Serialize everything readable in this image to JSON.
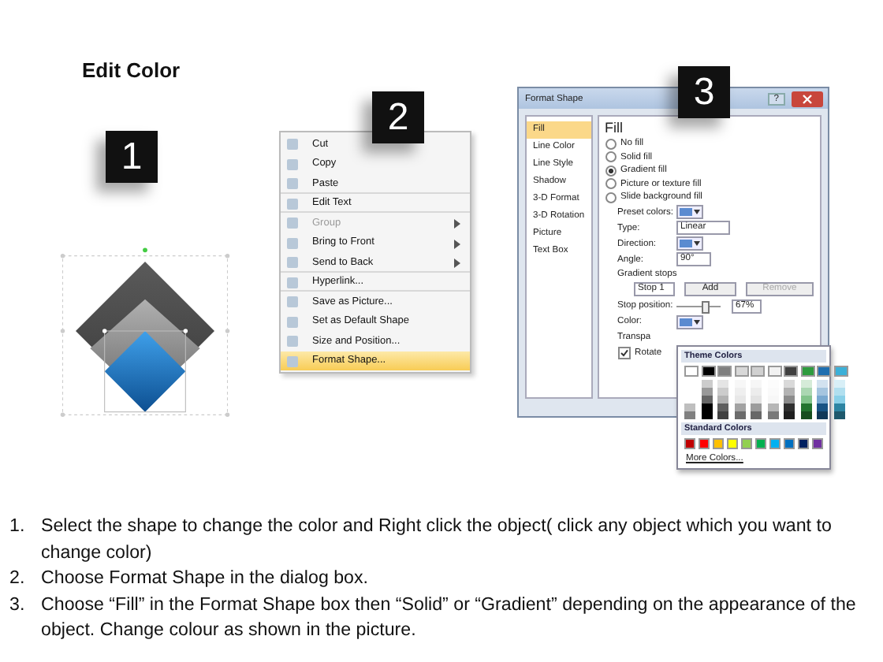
{
  "title": "Edit Color",
  "badges": [
    "1",
    "2",
    "3"
  ],
  "context_menu": {
    "items": [
      {
        "label": "Cut",
        "disabled": false,
        "submenu": false,
        "selected": false,
        "separator_after": false
      },
      {
        "label": "Copy",
        "disabled": false,
        "submenu": false,
        "selected": false,
        "separator_after": false
      },
      {
        "label": "Paste",
        "disabled": false,
        "submenu": false,
        "selected": false,
        "separator_after": true
      },
      {
        "label": "Edit Text",
        "disabled": false,
        "submenu": false,
        "selected": false,
        "separator_after": true
      },
      {
        "label": "Group",
        "disabled": true,
        "submenu": true,
        "selected": false,
        "separator_after": false
      },
      {
        "label": "Bring to Front",
        "disabled": false,
        "submenu": true,
        "selected": false,
        "separator_after": false
      },
      {
        "label": "Send to Back",
        "disabled": false,
        "submenu": true,
        "selected": false,
        "separator_after": true
      },
      {
        "label": "Hyperlink...",
        "disabled": false,
        "submenu": false,
        "selected": false,
        "separator_after": true
      },
      {
        "label": "Save as Picture...",
        "disabled": false,
        "submenu": false,
        "selected": false,
        "separator_after": false
      },
      {
        "label": "Set as Default Shape",
        "disabled": false,
        "submenu": false,
        "selected": false,
        "separator_after": false
      },
      {
        "label": "Size and Position...",
        "disabled": false,
        "submenu": false,
        "selected": false,
        "separator_after": false
      },
      {
        "label": "Format Shape...",
        "disabled": false,
        "submenu": false,
        "selected": true,
        "separator_after": false
      }
    ]
  },
  "dialog": {
    "title": "Format Shape",
    "help": "?",
    "sidebar": [
      {
        "label": "Fill",
        "selected": true
      },
      {
        "label": "Line Color",
        "selected": false
      },
      {
        "label": "Line Style",
        "selected": false
      },
      {
        "label": "Shadow",
        "selected": false
      },
      {
        "label": "3-D Format",
        "selected": false
      },
      {
        "label": "3-D Rotation",
        "selected": false
      },
      {
        "label": "Picture",
        "selected": false
      },
      {
        "label": "Text Box",
        "selected": false
      }
    ],
    "heading": "Fill",
    "fill_options": [
      {
        "label": "No fill",
        "selected": false
      },
      {
        "label": "Solid fill",
        "selected": false
      },
      {
        "label": "Gradient fill",
        "selected": true
      },
      {
        "label": "Picture or texture fill",
        "selected": false
      },
      {
        "label": "Slide background fill",
        "selected": false
      }
    ],
    "preset_label": "Preset colors:",
    "type_label": "Type:",
    "type_value": "Linear",
    "direction_label": "Direction:",
    "angle_label": "Angle:",
    "angle_value": "90°",
    "stops_label": "Gradient stops",
    "stop_value": "Stop 1",
    "add_button": "Add",
    "remove_button": {
      "label": "Remove",
      "disabled": true
    },
    "position_label": "Stop position:",
    "position": {
      "level": 0.67
    },
    "position_value": "67%",
    "color_label": "Color:",
    "transparency_label": "Transpa",
    "rotate": {
      "label": "Rotate",
      "checked": true
    },
    "color_popup": {
      "theme_title": "Theme Colors",
      "theme": [
        {
          "color": "#ffffff"
        },
        {
          "color": "#000000"
        },
        {
          "color": "#7f7f7f"
        },
        {
          "color": "#d8d8d8"
        },
        {
          "color": "#d0d0d0"
        },
        {
          "color": "#f2f2f2"
        },
        {
          "color": "#404040"
        },
        {
          "color": "#2e9b3e"
        },
        {
          "color": "#1f6fb0"
        },
        {
          "color": "#3cb0d8"
        }
      ],
      "standard_title": "Standard Colors",
      "standard": [
        {
          "color": "#c00000"
        },
        {
          "color": "#ff0000"
        },
        {
          "color": "#ffc000"
        },
        {
          "color": "#ffff00"
        },
        {
          "color": "#92d050"
        },
        {
          "color": "#00b050"
        },
        {
          "color": "#00b0f0"
        },
        {
          "color": "#0070c0"
        },
        {
          "color": "#002060"
        },
        {
          "color": "#7030a0"
        }
      ],
      "more": "More Colors..."
    }
  },
  "instructions": [
    {
      "number": "1.",
      "text": "Select the shape to change the color and Right click the object( click any object which you want to change color)"
    },
    {
      "number": "2.",
      "text": "Choose Format Shape in the dialog box."
    },
    {
      "number": "3.",
      "text": "Choose “Fill” in the Format Shape box then “Solid” or “Gradient” depending on the appearance of the object. Change colour as shown in the picture."
    }
  ]
}
